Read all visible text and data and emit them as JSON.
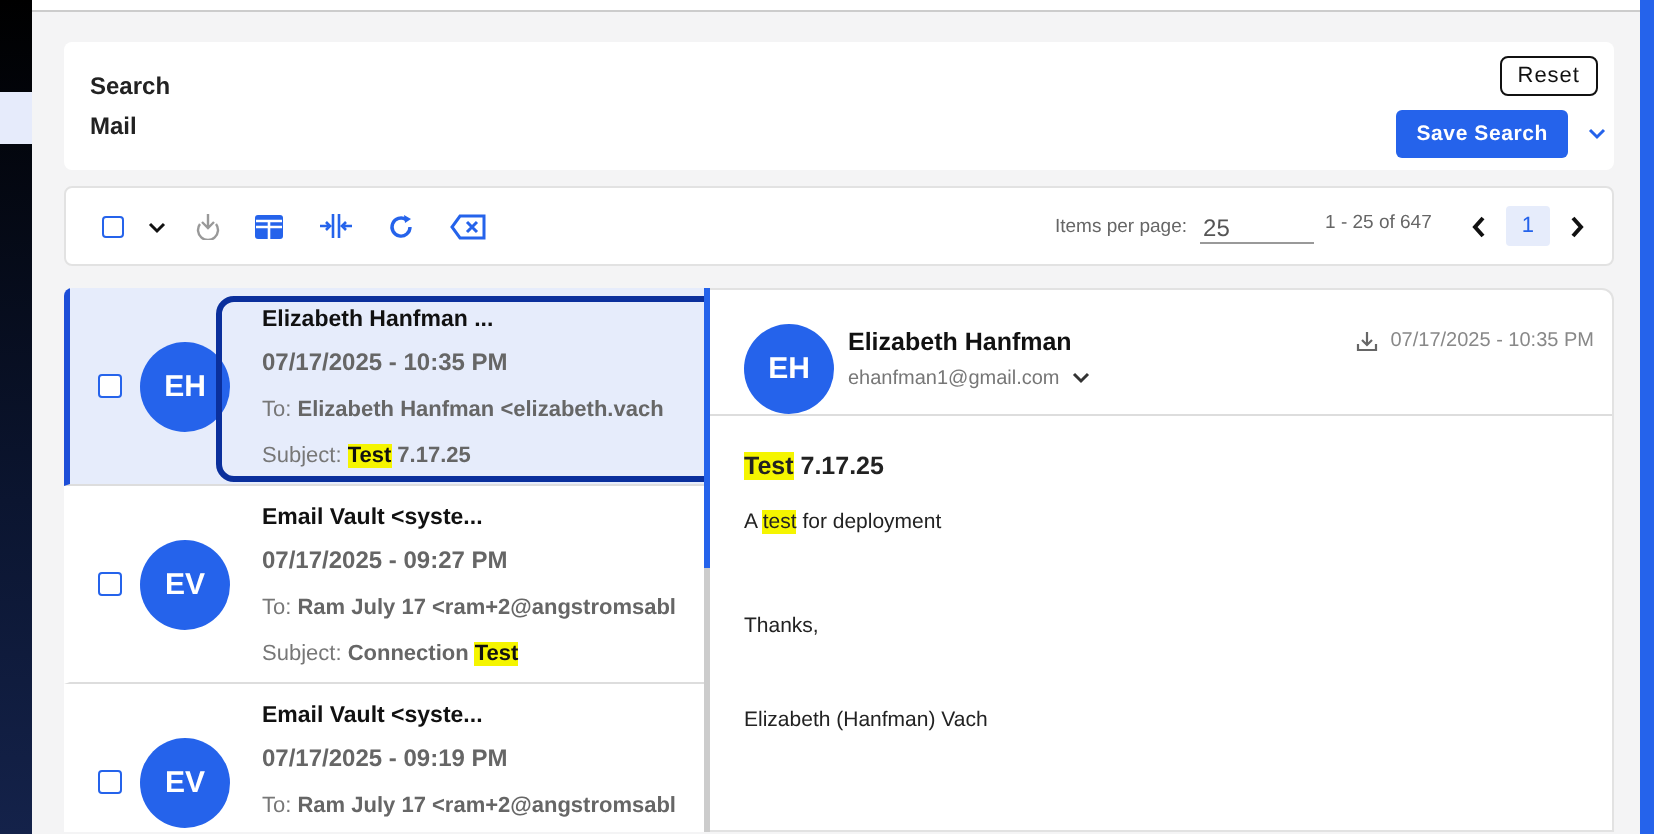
{
  "search_panel": {
    "title_lines": [
      "Search",
      "Mail"
    ],
    "reset_button": "Reset",
    "save_button": "Save Search"
  },
  "toolbar": {
    "select_all_checked": false,
    "items_per_page_label": "Items per page:",
    "items_per_page": "25",
    "range": "1 - 25 of 647",
    "pages": [
      {
        "label": "1",
        "selected": true
      }
    ]
  },
  "messages": [
    {
      "initials": "EH",
      "sender": "Elizabeth Hanfman ...",
      "date": "07/17/2025 - 10:35 PM",
      "to_label": "To:",
      "to": "Elizabeth Hanfman <elizabeth.vach",
      "subject_label": "Subject:",
      "subject": [
        {
          "text": "Test",
          "highlight": true
        },
        {
          "text": " 7.17.25",
          "highlight": false
        }
      ],
      "checked": false,
      "selected": true,
      "focused": true
    },
    {
      "initials": "EV",
      "sender": "Email Vault <syste...",
      "date": "07/17/2025 - 09:27 PM",
      "to_label": "To:",
      "to": "Ram July 17 <ram+2@angstromsabl",
      "subject_label": "Subject:",
      "subject": [
        {
          "text": "Connection ",
          "highlight": false
        },
        {
          "text": "Test",
          "highlight": true
        }
      ],
      "checked": false,
      "selected": false,
      "focused": false
    },
    {
      "initials": "EV",
      "sender": "Email Vault <syste...",
      "date": "07/17/2025 - 09:19 PM",
      "to_label": "To:",
      "to": "Ram July 17 <ram+2@angstromsabl",
      "checked": false,
      "selected": false,
      "focused": false
    }
  ],
  "preview": {
    "initials": "EH",
    "sender": "Elizabeth Hanfman",
    "email": "ehanfman1@gmail.com",
    "date": "07/17/2025 - 10:35 PM",
    "subject": [
      {
        "text": "Test",
        "highlight": true
      },
      {
        "text": " 7.17.25",
        "highlight": false
      }
    ],
    "body": [
      [
        {
          "text": "A ",
          "highlight": false
        },
        {
          "text": "test",
          "highlight": true
        },
        {
          "text": " for deployment",
          "highlight": false
        }
      ],
      [
        {
          "text": "Thanks,",
          "highlight": false
        }
      ],
      [
        {
          "text": "Elizabeth (Hanfman) Vach",
          "highlight": false
        }
      ]
    ]
  }
}
